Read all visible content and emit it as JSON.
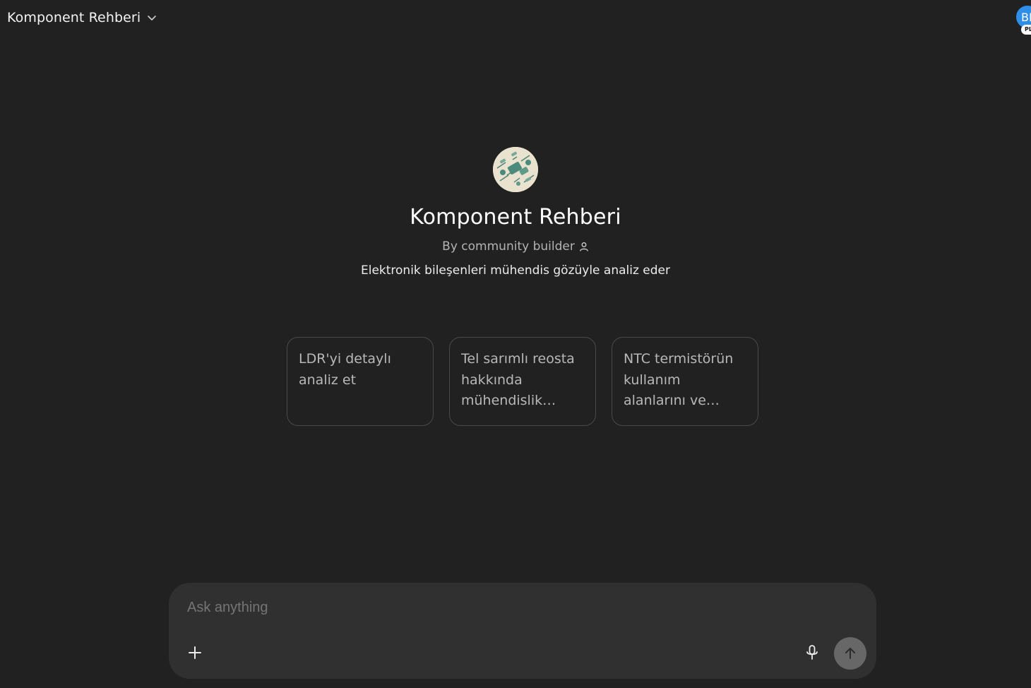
{
  "header": {
    "title": "Komponent Rehberi",
    "dropdown_icon": "chevron-down-icon",
    "avatar_initials": "BI",
    "plan_badge": "PLUS"
  },
  "gpt": {
    "logo_icon": "circuit-board-logo",
    "name": "Komponent Rehberi",
    "author": "By community builder",
    "author_icon": "person-icon",
    "description": "Elektronik bileşenleri mühendis gözüyle analiz eder"
  },
  "starters": [
    {
      "label": "LDR'yi detaylı analiz et"
    },
    {
      "label": "Tel sarımlı reosta hakkında mühendislik notları"
    },
    {
      "label": "NTC termistörün kullanım alanlarını ve ölçümünü açıkla"
    }
  ],
  "composer": {
    "placeholder": "Ask anything",
    "value": "",
    "plus_icon": "plus-icon",
    "mic_icon": "microphone-icon",
    "send_icon": "arrow-up-icon"
  },
  "colors": {
    "background": "#212121",
    "composer": "#303030",
    "avatar": "#2f8fe8",
    "send_button": "#676767"
  }
}
